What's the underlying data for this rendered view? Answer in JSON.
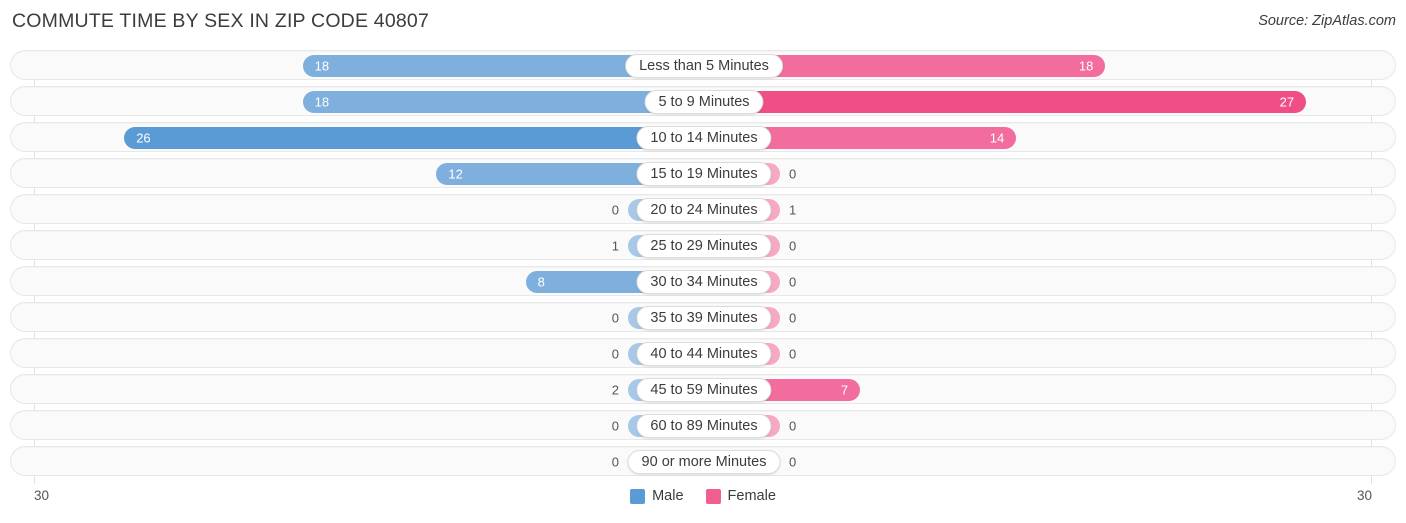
{
  "header": {
    "title": "COMMUTE TIME BY SEX IN ZIP CODE 40807",
    "source": "Source: ZipAtlas.com"
  },
  "axis": {
    "left_label": "30",
    "right_label": "30"
  },
  "legend": {
    "items": [
      {
        "label": "Male",
        "color": "#5b9bd5"
      },
      {
        "label": "Female",
        "color": "#ef5f92"
      }
    ]
  },
  "colors": {
    "male_strong": "#5b9bd5",
    "male_mid": "#7fb0dd",
    "male_light": "#a8c8e8",
    "female_strong": "#ef4e87",
    "female_mid": "#f26d9d",
    "female_light": "#f7a8c4",
    "track": "#fafafa",
    "track_border": "#e8e8e8",
    "gridline": "#e3e3e3"
  },
  "chart_data": {
    "type": "bar",
    "subtype": "diverging-bidirectional",
    "title": "COMMUTE TIME BY SEX IN ZIP CODE 40807",
    "xlabel": "",
    "ylabel": "",
    "xlim": [
      30,
      30
    ],
    "axis_max": 30,
    "grid": true,
    "legend_position": "bottom-center",
    "categories": [
      "Less than 5 Minutes",
      "5 to 9 Minutes",
      "10 to 14 Minutes",
      "15 to 19 Minutes",
      "20 to 24 Minutes",
      "25 to 29 Minutes",
      "30 to 34 Minutes",
      "35 to 39 Minutes",
      "40 to 44 Minutes",
      "45 to 59 Minutes",
      "60 to 89 Minutes",
      "90 or more Minutes"
    ],
    "series": [
      {
        "name": "Male",
        "values": [
          18,
          18,
          26,
          12,
          0,
          1,
          8,
          0,
          0,
          2,
          0,
          0
        ]
      },
      {
        "name": "Female",
        "values": [
          18,
          27,
          14,
          0,
          1,
          0,
          0,
          0,
          0,
          7,
          0,
          0
        ]
      }
    ]
  },
  "rows": [
    {
      "label": "Less than 5 Minutes",
      "male": "18",
      "female": "18"
    },
    {
      "label": "5 to 9 Minutes",
      "male": "18",
      "female": "27"
    },
    {
      "label": "10 to 14 Minutes",
      "male": "26",
      "female": "14"
    },
    {
      "label": "15 to 19 Minutes",
      "male": "12",
      "female": "0"
    },
    {
      "label": "20 to 24 Minutes",
      "male": "0",
      "female": "1"
    },
    {
      "label": "25 to 29 Minutes",
      "male": "1",
      "female": "0"
    },
    {
      "label": "30 to 34 Minutes",
      "male": "8",
      "female": "0"
    },
    {
      "label": "35 to 39 Minutes",
      "male": "0",
      "female": "0"
    },
    {
      "label": "40 to 44 Minutes",
      "male": "0",
      "female": "0"
    },
    {
      "label": "45 to 59 Minutes",
      "male": "2",
      "female": "7"
    },
    {
      "label": "60 to 89 Minutes",
      "male": "0",
      "female": "0"
    },
    {
      "label": "90 or more Minutes",
      "male": "0",
      "female": "0"
    }
  ]
}
